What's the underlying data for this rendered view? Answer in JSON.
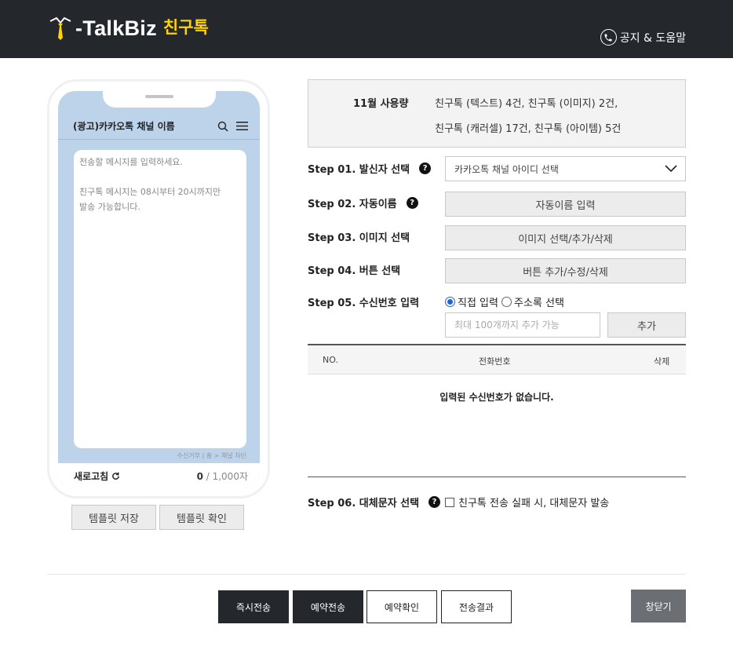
{
  "header": {
    "logo_text": "-TalkBiz",
    "logo_sub": "친구톡",
    "help_label": "공지 & 도움말"
  },
  "phone": {
    "channel_name": "(광고)카카오톡 채널 이름",
    "message_placeholder": "전송할 메시지를 입력하세요.\n\n친구톡 메시지는 08시부터 20시까지만\n발송 가능합니다.",
    "block_text": "수신거부 | 홈 > 채널 차단",
    "refresh_label": "새로고침",
    "count_current": "0",
    "count_max": " / 1,000자"
  },
  "template_buttons": {
    "save": "템플릿 저장",
    "check": "템플릿 확인"
  },
  "usage": {
    "month": "11월 사용량",
    "line1": "친구톡 (텍스트) 4건, 친구톡 (이미지) 2건,",
    "line2": "친구톡 (캐러셀) 17건, 친구톡 (아이템) 5건"
  },
  "steps": {
    "s1": {
      "label": "Step 01. 발신자 선택",
      "select_value": "카카오톡 채널 아이디 선택"
    },
    "s2": {
      "label": "Step 02. 자동이름",
      "button": "자동이름 입력"
    },
    "s3": {
      "label": "Step 03. 이미지 선택",
      "button": "이미지 선택/추가/삭제"
    },
    "s4": {
      "label": "Step 04. 버튼 선택",
      "button": "버튼 추가/수정/삭제"
    },
    "s5": {
      "label": "Step 05. 수신번호 입력",
      "radio_direct": "직접 입력",
      "radio_book": "주소록 선택",
      "input_placeholder": "최대 100개까지 추가 가능",
      "add_button": "추가"
    },
    "s6": {
      "label": "Step 06. 대체문자 선택",
      "checkbox_label": "친구톡 전송 실패 시, 대체문자 발송"
    }
  },
  "table": {
    "col_no": "NO.",
    "col_phone": "전화번호",
    "col_delete": "삭제",
    "empty_message": "입력된 수신번호가 없습니다."
  },
  "footer": {
    "send_now": "즉시전송",
    "send_reserved": "예약전송",
    "reserved_check": "예약확인",
    "send_result": "전송결과",
    "close": "창닫기"
  },
  "colors": {
    "header_bg": "#24282d",
    "logo_accent": "#ffd400",
    "phone_screen": "#bcd3ea"
  }
}
